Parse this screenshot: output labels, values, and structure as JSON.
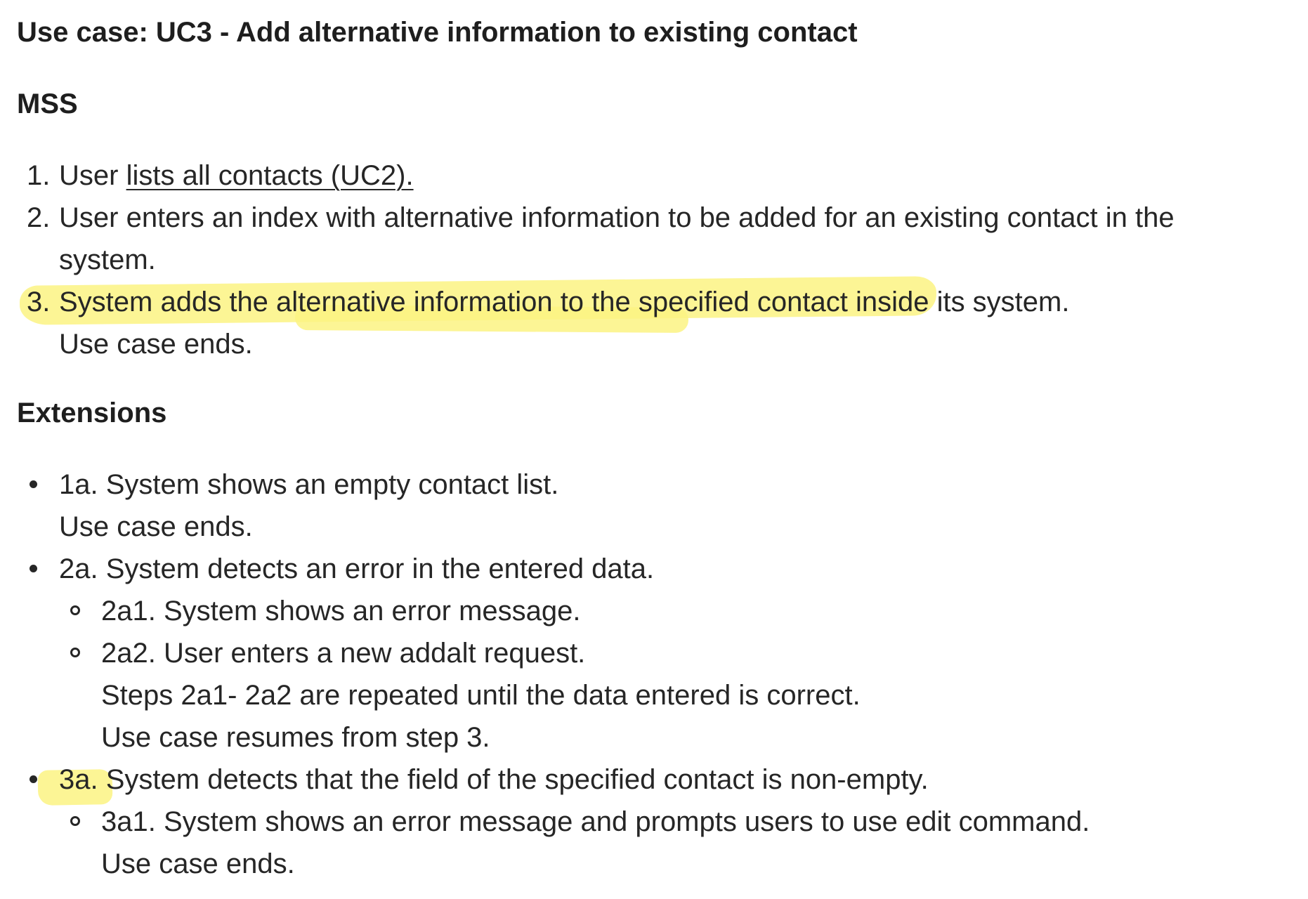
{
  "title": "Use case: UC3 - Add alternative information to existing contact",
  "mss": {
    "heading": "MSS",
    "step1": {
      "number": "1.",
      "prefix": "User ",
      "link": "lists all contacts (UC2)."
    },
    "step2": {
      "number": "2.",
      "line1": "User enters an index with alternative information to be added for an existing contact in the",
      "line2": "system."
    },
    "step3": {
      "number": "3.",
      "line1": "System adds the alternative information to the specified contact inside its system.",
      "line2": "Use case ends."
    }
  },
  "extensions": {
    "heading": "Extensions",
    "ext_1a": {
      "line1": "1a. System shows an empty contact list.",
      "line2": "Use case ends."
    },
    "ext_2a": {
      "line1": "2a. System detects an error in the entered data.",
      "sub1": "2a1. System shows an error message.",
      "sub2": "2a2. User enters a new addalt request.",
      "sub2_line2": "Steps 2a1- 2a2 are repeated until the data entered is correct.",
      "sub2_line3": "Use case resumes from step 3."
    },
    "ext_3a": {
      "line1": "3a. System detects that the field of the specified contact is non-empty.",
      "sub1": "3a1. System shows an error message and prompts users to use edit command.",
      "sub1_line2": "Use case ends."
    }
  },
  "colors": {
    "highlight": "#fbf383",
    "text": "#262626"
  }
}
